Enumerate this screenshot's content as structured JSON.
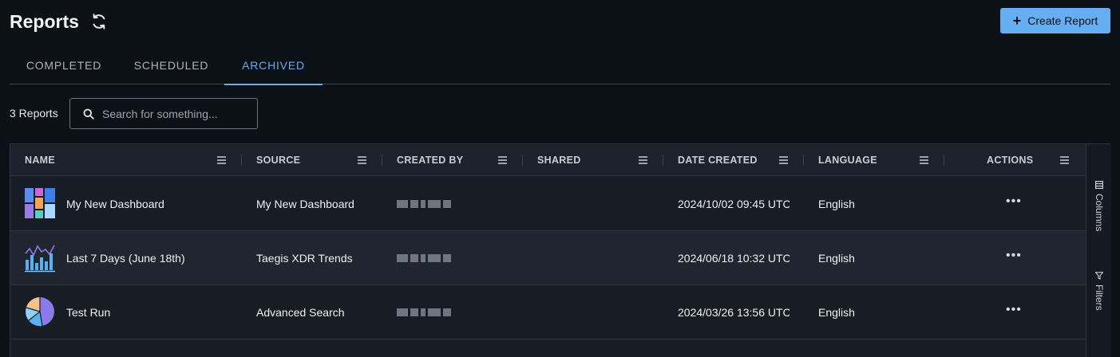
{
  "header": {
    "title": "Reports",
    "create_label": "Create Report"
  },
  "tabs": [
    {
      "label": "COMPLETED",
      "active": false
    },
    {
      "label": "SCHEDULED",
      "active": false
    },
    {
      "label": "ARCHIVED",
      "active": true
    }
  ],
  "toolbar": {
    "count_label": "3 Reports",
    "search_placeholder": "Search for something..."
  },
  "table": {
    "columns": [
      "NAME",
      "SOURCE",
      "CREATED BY",
      "SHARED",
      "DATE CREATED",
      "LANGUAGE",
      "ACTIONS"
    ],
    "rows": [
      {
        "icon": "dashboard-thumbnail-icon",
        "name": "My New Dashboard",
        "source": "My New Dashboard",
        "shared": "",
        "date": "2024/10/02 09:45 UTC",
        "language": "English"
      },
      {
        "icon": "trends-chart-thumbnail-icon",
        "name": "Last 7 Days (June 18th)",
        "source": "Taegis XDR Trends",
        "shared": "",
        "date": "2024/06/18 10:32 UTC",
        "language": "English"
      },
      {
        "icon": "pie-chart-thumbnail-icon",
        "name": "Test Run",
        "source": "Advanced Search",
        "shared": "",
        "date": "2024/03/26 13:56 UTC",
        "language": "English"
      }
    ]
  },
  "side_panel": {
    "columns_label": "Columns",
    "filters_label": "Filters"
  },
  "colors": {
    "accent": "#66aef2",
    "background": "#0c1117",
    "grid_background": "#171d25"
  }
}
